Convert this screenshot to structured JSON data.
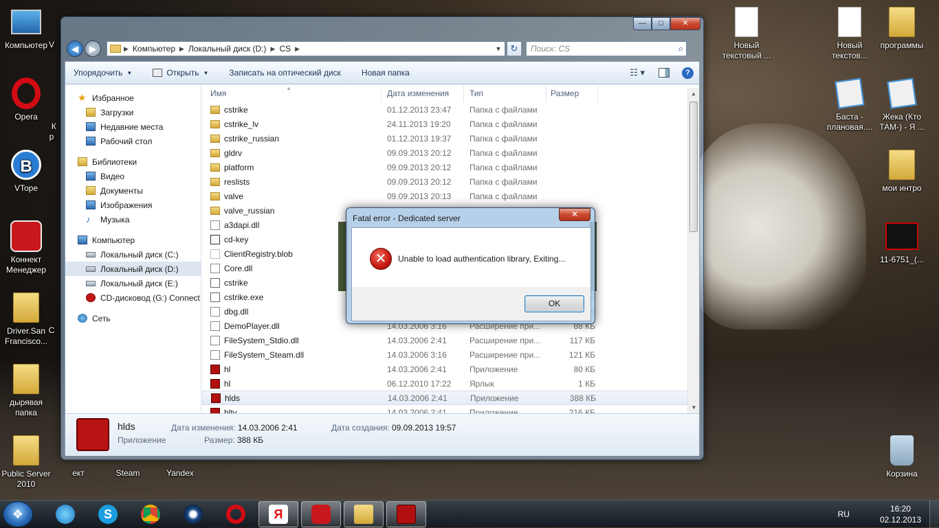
{
  "desktop": {
    "left_icons": [
      {
        "label": "Компьютер"
      },
      {
        "label": "Opera"
      },
      {
        "label": "VTope"
      },
      {
        "label": "Коннект Менеджер"
      },
      {
        "label": "Driver.San Francisco..."
      },
      {
        "label": "дырявая папка"
      },
      {
        "label": "Public Server 2010"
      }
    ],
    "partial_labels": {
      "left_k": "К\nр",
      "left_v": "V",
      "left_c": "С",
      "ekt": "ект",
      "steam": "Steam",
      "yandex": "Yandex"
    },
    "right_icons": [
      {
        "label": "Новый текстовый ..."
      },
      {
        "label": "Новый текстов..."
      },
      {
        "label": "программы"
      },
      {
        "label": "Баста - плановая...."
      },
      {
        "label": "Жека (Кто ТАМ-) - Я ..."
      },
      {
        "label": "мои интро"
      },
      {
        "label": "11-6751_(..."
      },
      {
        "label": "Корзина"
      }
    ]
  },
  "explorer": {
    "controls": {
      "minimize": "—",
      "maximize": "□",
      "close": "✕"
    },
    "address": {
      "crumbs": [
        "Компьютер",
        "Локальный диск (D:)",
        "CS"
      ],
      "separator": "▶",
      "dropdown": "▼"
    },
    "refresh": "↻",
    "search_placeholder": "Поиск: CS",
    "toolbar": {
      "organize": "Упорядочить",
      "open": "Открыть",
      "burn": "Записать на оптический диск",
      "new_folder": "Новая папка",
      "dd": "▼",
      "help": "?"
    },
    "nav": {
      "favorites": "Избранное",
      "downloads": "Загрузки",
      "recent": "Недавние места",
      "desktop": "Рабочий стол",
      "libraries": "Библиотеки",
      "video": "Видео",
      "documents": "Документы",
      "images": "Изображения",
      "music": "Музыка",
      "computer": "Компьютер",
      "drive_c": "Локальный диск (C:)",
      "drive_d": "Локальный диск (D:)",
      "drive_e": "Локальный диск (E:)",
      "cd_drive": "CD-дисковод (G:) Connect",
      "network": "Сеть"
    },
    "columns": {
      "name": "Имя",
      "date": "Дата изменения",
      "type": "Тип",
      "size": "Размер"
    },
    "files": [
      {
        "name": "cstrike",
        "date": "01.12.2013 23:47",
        "type": "Папка с файлами",
        "size": "",
        "icon": "folder-icon"
      },
      {
        "name": "cstrike_lv",
        "date": "24.11.2013 19:20",
        "type": "Папка с файлами",
        "size": "",
        "icon": "folder-icon"
      },
      {
        "name": "cstrike_russian",
        "date": "01.12.2013 19:37",
        "type": "Папка с файлами",
        "size": "",
        "icon": "folder-icon"
      },
      {
        "name": "gldrv",
        "date": "09.09.2013 20:12",
        "type": "Папка с файлами",
        "size": "",
        "icon": "folder-icon"
      },
      {
        "name": "platform",
        "date": "09.09.2013 20:12",
        "type": "Папка с файлами",
        "size": "",
        "icon": "folder-icon"
      },
      {
        "name": "reslists",
        "date": "09.09.2013 20:12",
        "type": "Папка с файлами",
        "size": "",
        "icon": "folder-icon"
      },
      {
        "name": "valve",
        "date": "09.09.2013 20:13",
        "type": "Папка с файлами",
        "size": "",
        "icon": "folder-icon"
      },
      {
        "name": "valve_russian",
        "date": "",
        "type": "",
        "size": "",
        "icon": "folder-icon"
      },
      {
        "name": "a3dapi.dll",
        "date": "",
        "type": "",
        "size": "",
        "icon": "dll-icon"
      },
      {
        "name": "cd-key",
        "date": "",
        "type": "",
        "size": "",
        "icon": "key-icon"
      },
      {
        "name": "ClientRegistry.blob",
        "date": "",
        "type": "",
        "size": "",
        "icon": "blob-icon"
      },
      {
        "name": "Core.dll",
        "date": "",
        "type": "",
        "size": "",
        "icon": "dll-icon"
      },
      {
        "name": "cstrike",
        "date": "",
        "type": "",
        "size": "",
        "icon": "cs-icon"
      },
      {
        "name": "cstrike.exe",
        "date": "",
        "type": "",
        "size": "Б",
        "icon": "cs-icon"
      },
      {
        "name": "dbg.dll",
        "date": "",
        "type": "",
        "size": "Б",
        "icon": "dll-icon"
      },
      {
        "name": "DemoPlayer.dll",
        "date": "14.03.2006 3:16",
        "type": "Расширение при...",
        "size": "88 КБ",
        "icon": "dll-icon"
      },
      {
        "name": "FileSystem_Stdio.dll",
        "date": "14.03.2006 2:41",
        "type": "Расширение при...",
        "size": "117 КБ",
        "icon": "dll-icon"
      },
      {
        "name": "FileSystem_Steam.dll",
        "date": "14.03.2006 3:16",
        "type": "Расширение при...",
        "size": "121 КБ",
        "icon": "dll-icon"
      },
      {
        "name": "hl",
        "date": "14.03.2006 2:41",
        "type": "Приложение",
        "size": "80 КБ",
        "icon": "halflife-icon"
      },
      {
        "name": "hl",
        "date": "06.12.2010 17:22",
        "type": "Ярлык",
        "size": "1 КБ",
        "icon": "halflife-icon"
      },
      {
        "name": "hlds",
        "date": "14.03.2006 2:41",
        "type": "Приложение",
        "size": "388 КБ",
        "icon": "halflife-icon",
        "selected": true
      },
      {
        "name": "hltv",
        "date": "14.03.2006 2:41",
        "type": "Приложение",
        "size": "216 КБ",
        "icon": "halflife-icon"
      }
    ],
    "scroll": {
      "up": "▲",
      "down": "▼"
    },
    "details": {
      "name": "hlds",
      "type": "Приложение",
      "modified_label": "Дата изменения:",
      "modified": "14.03.2006 2:41",
      "size_label": "Размер:",
      "size": "388 КБ",
      "created_label": "Дата создания:",
      "created": "09.09.2013 19:57"
    }
  },
  "dialog": {
    "title": "Fatal error - Dedicated server",
    "close": "✕",
    "icon": "✕",
    "message": "Unable to load authentication library, Exiting...",
    "ok": "OK"
  },
  "taskbar": {
    "start": "❖",
    "skype": "S",
    "yandex": "Я",
    "lang": "RU",
    "time": "16:20",
    "date": "02.12.2013"
  }
}
